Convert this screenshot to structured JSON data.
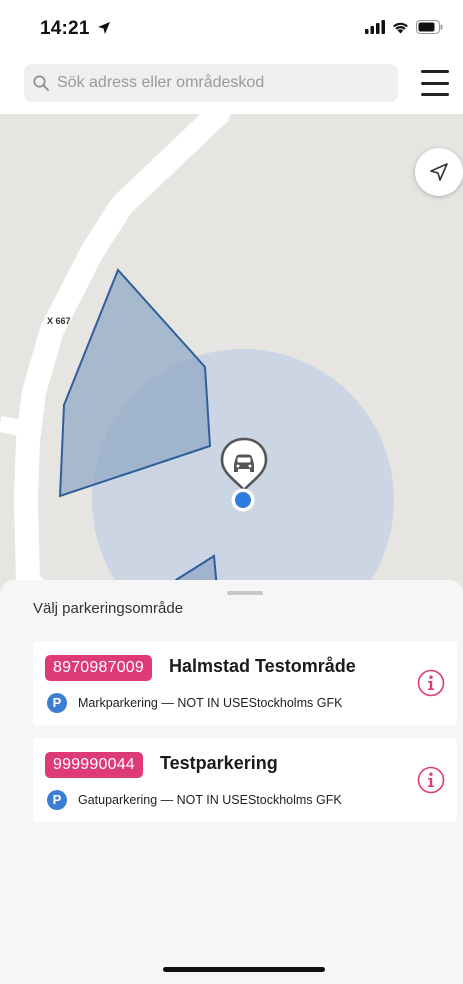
{
  "status_bar": {
    "time": "14:21",
    "icons": [
      "location-arrow-icon",
      "cellular-signal-icon",
      "wifi-icon",
      "battery-icon"
    ]
  },
  "search": {
    "placeholder": "Sök adress eller områdeskod",
    "icon": "search-icon"
  },
  "menu": {
    "icon": "hamburger-menu-icon"
  },
  "map": {
    "road_label": "X 667",
    "locate_icon": "navigation-arrow-icon",
    "marker_icon": "car-icon",
    "colors": {
      "background": "#e7e5e2",
      "road": "#ffffff",
      "zone_fill": "#8fa8c4",
      "zone_stroke": "#2f5f9a",
      "radius_fill": "#c6d2e4",
      "location_dot": "#2f7be0"
    }
  },
  "sheet": {
    "title": "Välj parkeringsområde",
    "areas": [
      {
        "code": "8970987009",
        "name": "Halmstad Testområde",
        "detail": "Markparkering — NOT IN USEStockholms GFK",
        "parking_icon_label": "P"
      },
      {
        "code": "999990044",
        "name": "Testparkering",
        "detail": "Gatuparkering — NOT IN USEStockholms GFK",
        "parking_icon_label": "P"
      }
    ]
  },
  "colors": {
    "accent": "#df3a78",
    "parking_icon": "#3b7fd4"
  }
}
